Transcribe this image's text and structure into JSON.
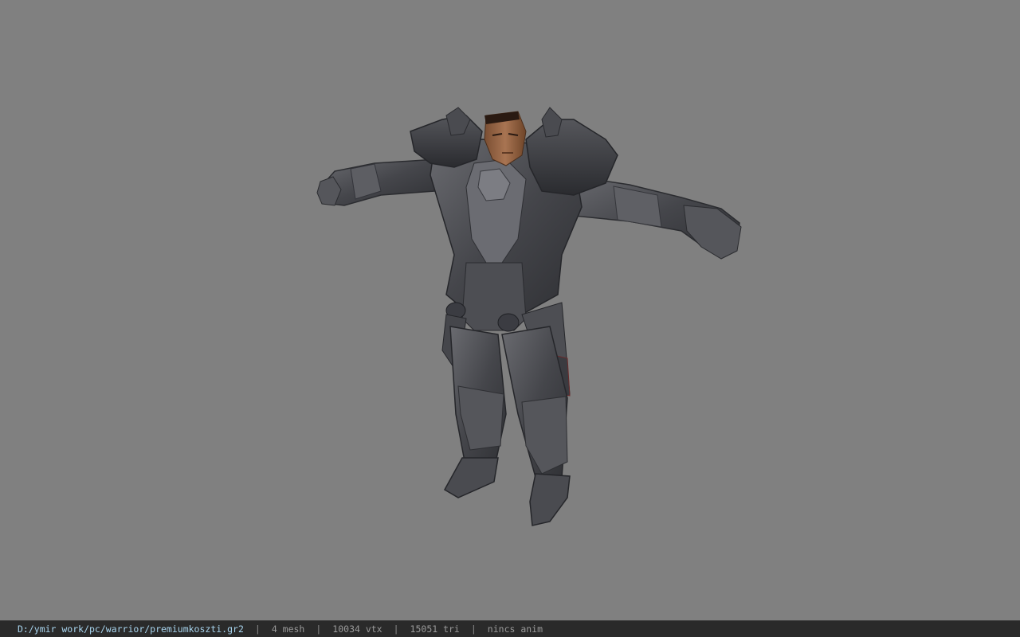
{
  "viewer": {
    "background_color": "#808080",
    "model_subject": "armored warrior character (T-pose)",
    "armor_color": "#4a4b50",
    "skin_color": "#9a6a48"
  },
  "statusbar": {
    "file_path": "D:/ymir work/pc/warrior/premiumkoszti.gr2",
    "mesh_count": "4 mesh",
    "vertex_count": "10034 vtx",
    "triangle_count": "15051 tri",
    "animation": "nincs anim",
    "separator": "|"
  },
  "colors": {
    "statusbar_bg": "#2a2a2a",
    "path_text": "#a8d4ee",
    "info_text": "#9a9a9a"
  }
}
